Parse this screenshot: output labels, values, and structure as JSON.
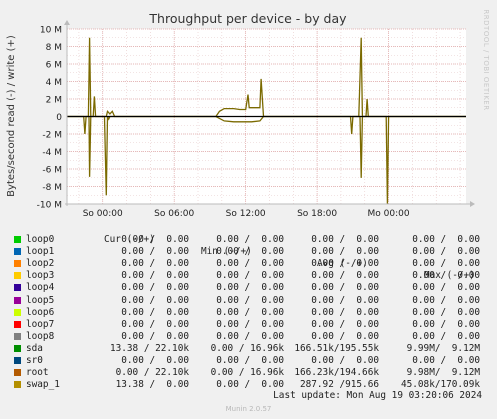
{
  "chart_data": {
    "type": "line",
    "title": "Throughput per device - by day",
    "ylabel": "Bytes/second read (-) / write (+)",
    "side_label": "RRDTOOL / TOBI OETIKER",
    "ylim": [
      -10000000,
      10000000
    ],
    "yticks": [
      {
        "v": 10000000,
        "label": "10 M"
      },
      {
        "v": 8000000,
        "label": "8 M"
      },
      {
        "v": 6000000,
        "label": "6 M"
      },
      {
        "v": 4000000,
        "label": "4 M"
      },
      {
        "v": 2000000,
        "label": "2 M"
      },
      {
        "v": 0,
        "label": "0"
      },
      {
        "v": -2000000,
        "label": "-2 M"
      },
      {
        "v": -4000000,
        "label": "-4 M"
      },
      {
        "v": -6000000,
        "label": "-6 M"
      },
      {
        "v": -8000000,
        "label": "-8 M"
      },
      {
        "v": -10000000,
        "label": "-10 M"
      }
    ],
    "xlim": [
      -3,
      30.5
    ],
    "xticks": [
      {
        "v": 0,
        "label": "So 00:00"
      },
      {
        "v": 6,
        "label": "So 06:00"
      },
      {
        "v": 12,
        "label": "So 12:00"
      },
      {
        "v": 18,
        "label": "So 18:00"
      },
      {
        "v": 24,
        "label": "Mo 00:00"
      }
    ],
    "grid": true,
    "series": [
      {
        "name": "sda",
        "color": "#7b6a00",
        "write_points": [
          [
            -3,
            0
          ],
          [
            -1.9,
            0
          ],
          [
            -1.2,
            0
          ],
          [
            -1.1,
            9000000
          ],
          [
            -1,
            0
          ],
          [
            -0.8,
            0
          ],
          [
            -0.7,
            2300000
          ],
          [
            -0.6,
            0
          ],
          [
            0.3,
            0
          ],
          [
            0.4,
            600000
          ],
          [
            0.6,
            300000
          ],
          [
            0.8,
            600000
          ],
          [
            1,
            0
          ],
          [
            9.5,
            0
          ],
          [
            9.8,
            600000
          ],
          [
            10.2,
            900000
          ],
          [
            11,
            900000
          ],
          [
            11.5,
            800000
          ],
          [
            12,
            800000
          ],
          [
            12.2,
            2500000
          ],
          [
            12.3,
            1000000
          ],
          [
            13.2,
            1000000
          ],
          [
            13.3,
            4300000
          ],
          [
            13.5,
            0
          ],
          [
            21.5,
            0
          ],
          [
            21.7,
            9000000
          ],
          [
            21.8,
            0
          ],
          [
            22.1,
            0
          ],
          [
            22.2,
            2000000
          ],
          [
            22.3,
            0
          ],
          [
            30.5,
            0
          ]
        ],
        "read_points": [
          [
            -3,
            0
          ],
          [
            -1.6,
            0
          ],
          [
            -1.5,
            -2000000
          ],
          [
            -1.4,
            0
          ],
          [
            -1.15,
            0
          ],
          [
            -1.1,
            -6900000
          ],
          [
            -1,
            0
          ],
          [
            0.15,
            0
          ],
          [
            0.3,
            -9000000
          ],
          [
            0.4,
            0
          ],
          [
            0.5,
            -300000
          ],
          [
            0.6,
            0
          ],
          [
            9.5,
            0
          ],
          [
            10.2,
            -500000
          ],
          [
            11,
            -600000
          ],
          [
            12.5,
            -600000
          ],
          [
            13.2,
            -500000
          ],
          [
            13.5,
            0
          ],
          [
            20.8,
            0
          ],
          [
            20.9,
            -2000000
          ],
          [
            21,
            0
          ],
          [
            21.6,
            0
          ],
          [
            21.7,
            -7000000
          ],
          [
            21.8,
            0
          ],
          [
            23.8,
            0
          ],
          [
            23.9,
            -10000000
          ],
          [
            24,
            0
          ],
          [
            30.5,
            0
          ]
        ]
      }
    ]
  },
  "legend": {
    "headers": [
      "Cur (-/+)",
      "Min (-/+)",
      "Avg (-/+)",
      "Max (-/+)"
    ],
    "rows": [
      {
        "name": "loop0",
        "color": "#00cc00",
        "cur": "0.00 /  0.00",
        "min": "0.00 /  0.00",
        "avg": "0.00 /  0.00",
        "max": "0.00 /  0.00"
      },
      {
        "name": "loop1",
        "color": "#0066b3",
        "cur": "0.00 /  0.00",
        "min": "0.00 /  0.00",
        "avg": "0.00 /  0.00",
        "max": "0.00 /  0.00"
      },
      {
        "name": "loop2",
        "color": "#ff8000",
        "cur": "0.00 /  0.00",
        "min": "0.00 /  0.00",
        "avg": "0.00 /  0.00",
        "max": "0.00 /  0.00"
      },
      {
        "name": "loop3",
        "color": "#ffcc00",
        "cur": "0.00 /  0.00",
        "min": "0.00 /  0.00",
        "avg": "0.00 /  0.00",
        "max": "0.00 /  0.00"
      },
      {
        "name": "loop4",
        "color": "#330099",
        "cur": "0.00 /  0.00",
        "min": "0.00 /  0.00",
        "avg": "0.00 /  0.00",
        "max": "0.00 /  0.00"
      },
      {
        "name": "loop5",
        "color": "#990099",
        "cur": "0.00 /  0.00",
        "min": "0.00 /  0.00",
        "avg": "0.00 /  0.00",
        "max": "0.00 /  0.00"
      },
      {
        "name": "loop6",
        "color": "#ccff00",
        "cur": "0.00 /  0.00",
        "min": "0.00 /  0.00",
        "avg": "0.00 /  0.00",
        "max": "0.00 /  0.00"
      },
      {
        "name": "loop7",
        "color": "#ff0000",
        "cur": "0.00 /  0.00",
        "min": "0.00 /  0.00",
        "avg": "0.00 /  0.00",
        "max": "0.00 /  0.00"
      },
      {
        "name": "loop8",
        "color": "#808080",
        "cur": "0.00 /  0.00",
        "min": "0.00 /  0.00",
        "avg": "0.00 /  0.00",
        "max": "0.00 /  0.00"
      },
      {
        "name": "sda",
        "color": "#008f00",
        "cur": "13.38 / 22.10k",
        "min": "0.00 / 16.96k",
        "avg": "166.51k/195.55k",
        "max": "9.99M/  9.12M"
      },
      {
        "name": "sr0",
        "color": "#00487d",
        "cur": "0.00 /  0.00",
        "min": "0.00 /  0.00",
        "avg": "0.00 /  0.00",
        "max": "0.00 /  0.00"
      },
      {
        "name": "root",
        "color": "#b35a00",
        "cur": "0.00 / 22.10k",
        "min": "0.00 / 16.96k",
        "avg": "166.23k/194.66k",
        "max": "9.98M/  9.12M"
      },
      {
        "name": "swap_1",
        "color": "#b38f00",
        "cur": "13.38 /  0.00",
        "min": "0.00 /  0.00",
        "avg": "287.92 /915.66",
        "max": "45.08k/170.09k"
      }
    ]
  },
  "last_update": "Last update: Mon Aug 19 03:20:06 2024",
  "version": "Munin 2.0.57"
}
